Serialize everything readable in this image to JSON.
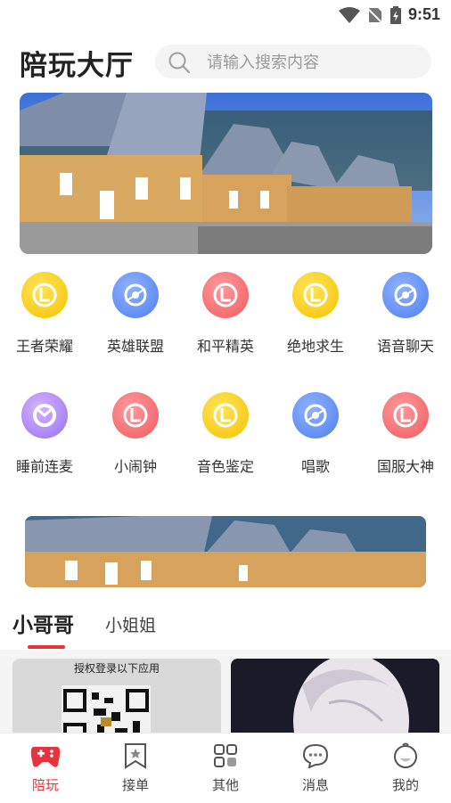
{
  "status_bar": {
    "time": "9:51"
  },
  "header": {
    "title": "陪玩大厅"
  },
  "search": {
    "placeholder": "请输入搜索内容"
  },
  "categories": [
    {
      "label": "王者荣耀",
      "icon": "yellow-l-icon"
    },
    {
      "label": "英雄联盟",
      "icon": "blue-swirl-icon"
    },
    {
      "label": "和平精英",
      "icon": "red-l-icon"
    },
    {
      "label": "绝地求生",
      "icon": "yellow-l-icon"
    },
    {
      "label": "语音聊天",
      "icon": "blue-swirl-icon"
    },
    {
      "label": "睡前连麦",
      "icon": "purple-ring-icon"
    },
    {
      "label": "小闹钟",
      "icon": "red-l-icon"
    },
    {
      "label": "音色鉴定",
      "icon": "yellow-l-icon"
    },
    {
      "label": "唱歌",
      "icon": "blue-swirl-icon"
    },
    {
      "label": "国服大神",
      "icon": "red-l-icon"
    }
  ],
  "tabs": [
    {
      "label": "小哥哥",
      "active": true
    },
    {
      "label": "小姐姐",
      "active": false
    }
  ],
  "cards": [
    {
      "caption": "授权登录以下应用"
    },
    {
      "caption": ""
    }
  ],
  "bottom_nav": [
    {
      "label": "陪玩",
      "icon": "gamepad-icon",
      "active": true
    },
    {
      "label": "接单",
      "icon": "bookmark-star-icon",
      "active": false
    },
    {
      "label": "其他",
      "icon": "apps-icon",
      "active": false
    },
    {
      "label": "消息",
      "icon": "chat-bubble-icon",
      "active": false
    },
    {
      "label": "我的",
      "icon": "profile-face-icon",
      "active": false
    }
  ],
  "colors": {
    "accent": "#e5343d",
    "search_bg": "#f4f4f4"
  }
}
